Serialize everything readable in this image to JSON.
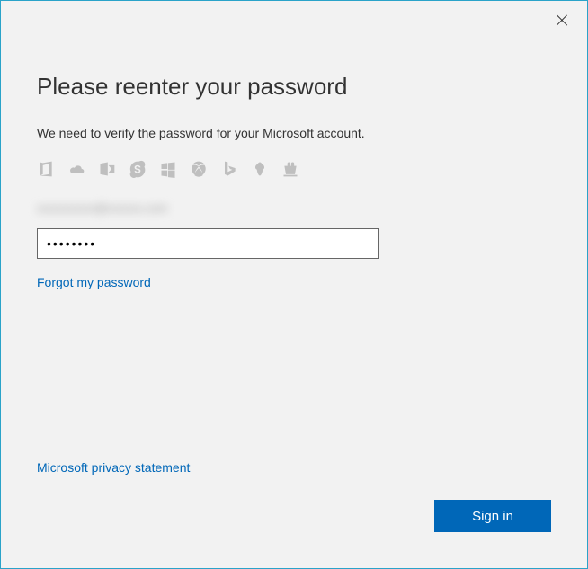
{
  "dialog": {
    "title": "Please reenter your password",
    "subtitle": "We need to verify the password for your Microsoft account.",
    "email_obscured": "xxxxxxxxxx@xxxxxx.com",
    "password_value": "••••••••",
    "forgot_link": "Forgot my password",
    "privacy_link": "Microsoft privacy statement",
    "sign_in_label": "Sign in"
  },
  "icons": [
    "office-icon",
    "onedrive-icon",
    "outlook-icon",
    "skype-icon",
    "windows-icon",
    "xbox-icon",
    "bing-icon",
    "msn-icon",
    "store-icon"
  ],
  "colors": {
    "accent": "#0067b8",
    "border": "#2aa3c9",
    "background": "#f2f2f2",
    "icon": "#bfbfbf"
  }
}
